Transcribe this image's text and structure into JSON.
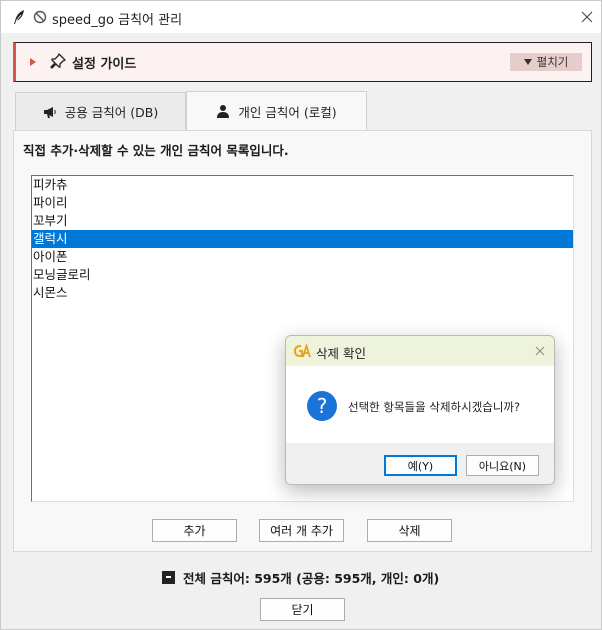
{
  "window": {
    "title": "speed_go 금칙어 관리"
  },
  "guide": {
    "title": "설정 가이드",
    "expand_label": "펼치기"
  },
  "tabs": [
    {
      "label": "공용 금칙어 (DB)",
      "icon": "megaphone-icon"
    },
    {
      "label": "개인 금칙어 (로컬)",
      "icon": "person-icon"
    }
  ],
  "panel": {
    "description": "직접 추가·삭제할 수 있는 개인 금칙어 목록입니다.",
    "items": [
      "피카츄",
      "파이리",
      "꼬부기",
      "갤럭시",
      "아이폰",
      "모닝글로리",
      "시몬스"
    ],
    "selected_index": 3
  },
  "buttons": {
    "add": "추가",
    "add_multiple": "여러 개 추가",
    "delete": "삭제",
    "close": "닫기"
  },
  "summary": {
    "text": "전체 금칙어: 595개 (공용: 595개, 개인: 0개)"
  },
  "dialog": {
    "title": "삭제 확인",
    "message": "선택한 항목들을 삭제하시겠습니까?",
    "yes": "예(Y)",
    "no": "아니요(N)"
  },
  "colors": {
    "accent": "#0078d7",
    "guide_accent": "#d9534f",
    "dialog_title_bg": "#eef3dc"
  }
}
